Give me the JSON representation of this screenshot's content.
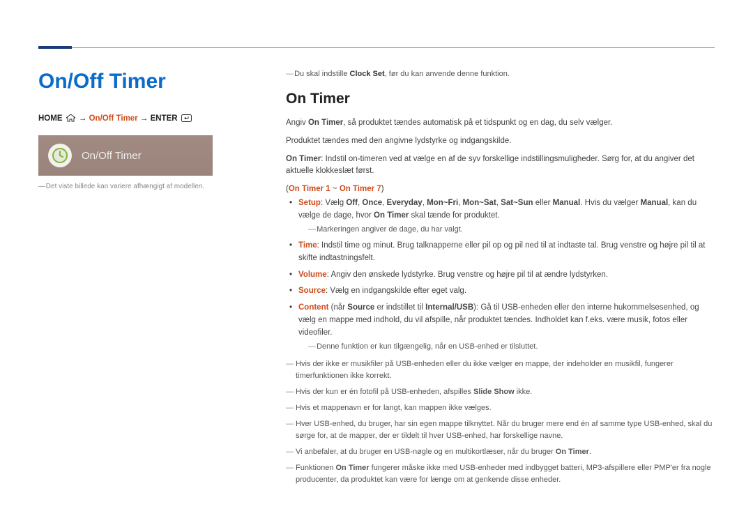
{
  "page": {
    "title": "On/Off Timer"
  },
  "breadcrumb": {
    "home": "HOME",
    "path": "On/Off Timer",
    "enter": "ENTER"
  },
  "screenshot": {
    "label": "On/Off Timer"
  },
  "left_note": "Det viste billede kan variere afhængigt af modellen.",
  "top_note": {
    "pre": "Du skal indstille ",
    "bold": "Clock Set",
    "post": ", før du kan anvende denne funktion."
  },
  "section_title": "On Timer",
  "p1": {
    "pre": "Angiv ",
    "bold": "On Timer",
    "post": ", så produktet tændes automatisk på et tidspunkt og en dag, du selv vælger."
  },
  "p2": "Produktet tændes med den angivne lydstyrke og indgangskilde.",
  "p3": {
    "bold": "On Timer",
    "post": ": Indstil on-timeren ved at vælge en af de syv forskellige indstillingsmuligheder. Sørg for, at du angiver det aktuelle klokkeslæt først."
  },
  "paren": {
    "open": "(",
    "bold": "On Timer 1",
    "mid": " ~ ",
    "bold2": "On Timer 7",
    "close": ")"
  },
  "bullets": {
    "setup": {
      "label": "Setup",
      "colon": ": Vælg ",
      "opts": [
        "Off",
        "Once",
        "Everyday",
        "Mon~Fri",
        "Mon~Sat",
        "Sat~Sun"
      ],
      "or": " eller ",
      "manual": "Manual",
      "tail": ". Hvis du vælger ",
      "manual2": "Manual",
      "tail2": ", kan du vælge de dage, hvor ",
      "ontimer": "On Timer",
      "tail3": " skal tænde for produktet."
    },
    "setup_sub": "Markeringen angiver de dage, du har valgt.",
    "time": {
      "label": "Time",
      "text": ": Indstil time og minut. Brug talknapperne eller pil op og pil ned til at indtaste tal. Brug venstre og højre pil til at skifte indtastningsfelt."
    },
    "volume": {
      "label": "Volume",
      "text": ": Angiv den ønskede lydstyrke. Brug venstre og højre pil til at ændre lydstyrken."
    },
    "source": {
      "label": "Source",
      "text": ": Vælg en indgangskilde efter eget valg."
    },
    "content": {
      "label": "Content",
      "pre": " (når ",
      "src": "Source",
      "mid": " er indstillet til ",
      "iusb": "Internal/USB",
      "post": "): Gå til USB-enheden eller den interne hukommelsesenhed, og vælg en mappe med indhold, du vil afspille, når produktet tændes. Indholdet kan f.eks. være musik, fotos eller videofiler."
    },
    "content_sub": "Denne funktion er kun tilgængelig, når en USB-enhed er tilsluttet."
  },
  "footnotes": {
    "n1": "Hvis der ikke er musikfiler på USB-enheden eller du ikke vælger en mappe, der indeholder en musikfil, fungerer timerfunktionen ikke korrekt.",
    "n2": {
      "pre": "Hvis der kun er én fotofil på USB-enheden, afspilles ",
      "bold": "Slide Show",
      "post": " ikke."
    },
    "n3": "Hvis et mappenavn er for langt, kan mappen ikke vælges.",
    "n4": "Hver USB-enhed, du bruger, har sin egen mappe tilknyttet. Når du bruger mere end én af samme type USB-enhed, skal du sørge for, at de mapper, der er tildelt til hver USB-enhed, har forskellige navne.",
    "n5": {
      "pre": "Vi anbefaler, at du bruger en USB-nøgle og en multikortlæser, når du bruger ",
      "bold": "On Timer",
      "post": "."
    },
    "n6": {
      "pre": "Funktionen ",
      "bold": "On Timer",
      "post": " fungerer måske ikke med USB-enheder med indbygget batteri, MP3-afspillere eller PMP'er fra nogle producenter, da produktet kan være for længe om at genkende disse enheder."
    }
  }
}
